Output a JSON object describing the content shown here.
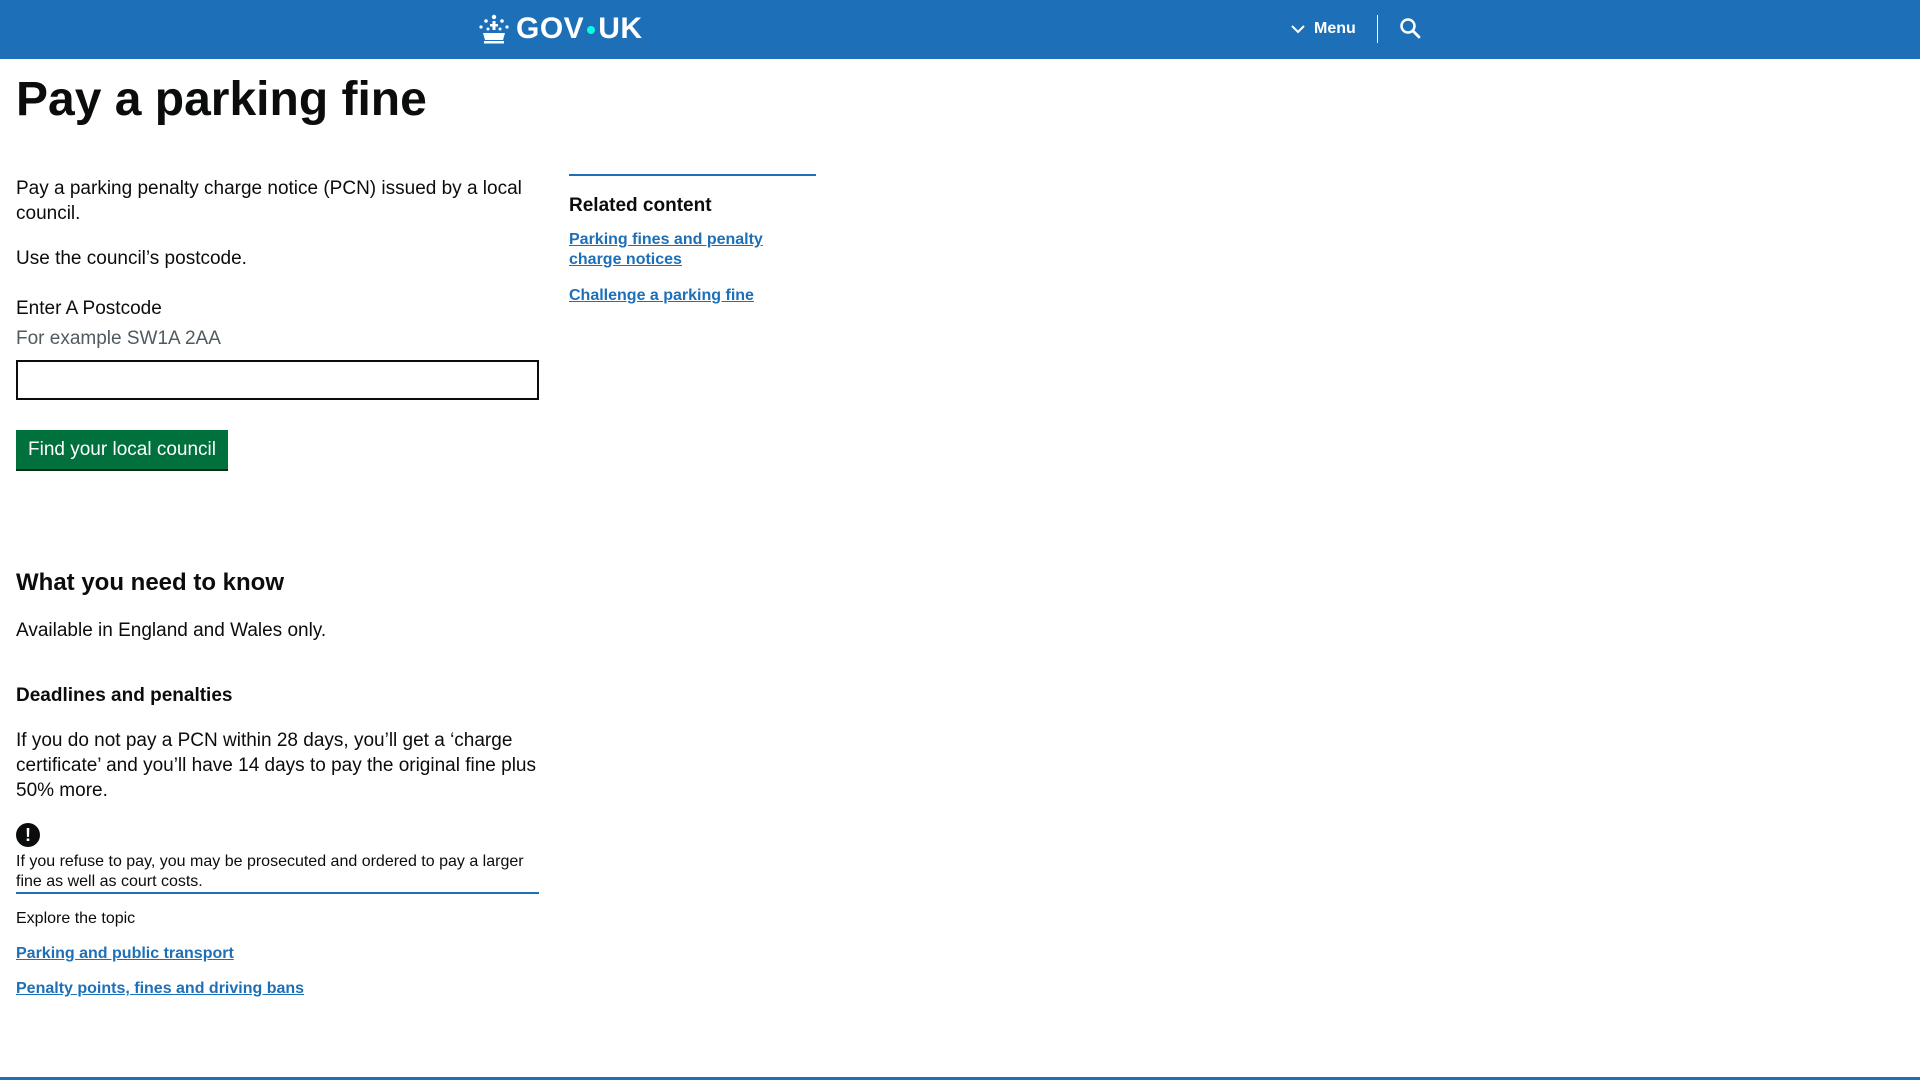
{
  "header": {
    "logo_text_left": "GOV",
    "logo_text_right": "UK",
    "menu_label": "Menu",
    "brand_color": "#1d70b8"
  },
  "page": {
    "title": "Pay a parking fine",
    "intro": [
      "Pay a parking penalty charge notice (PCN) issued by a local council.",
      "Use the council’s postcode."
    ]
  },
  "form": {
    "label": "Enter A Postcode",
    "hint": "For example SW1A 2AA",
    "postcode_value": "",
    "button_label": "Find your local council",
    "button_color": "#00703c"
  },
  "related": {
    "heading": "Related content",
    "links": [
      "Parking fines and penalty charge notices",
      "Challenge a parking fine"
    ]
  },
  "need_to_know": {
    "heading": "What you need to know",
    "availability": "Available in England and Wales only.",
    "deadlines_heading": "Deadlines and penalties",
    "deadlines_body": "If you do not pay a PCN within 28 days, you’ll get a ‘charge certificate’ and you’ll have 14 days to pay the original fine plus 50% more.",
    "warning_icon": "!",
    "warning_text": "If you refuse to pay, you may be prosecuted and ordered to pay a larger fine as well as court costs."
  },
  "explore": {
    "title": "Explore the topic",
    "links": [
      "Parking and public transport",
      "Penalty points, fines and driving bans"
    ]
  },
  "icons": {
    "crown": "crown-icon",
    "chevron": "chevron-down-icon",
    "search": "search-icon",
    "warning": "warning-icon"
  }
}
